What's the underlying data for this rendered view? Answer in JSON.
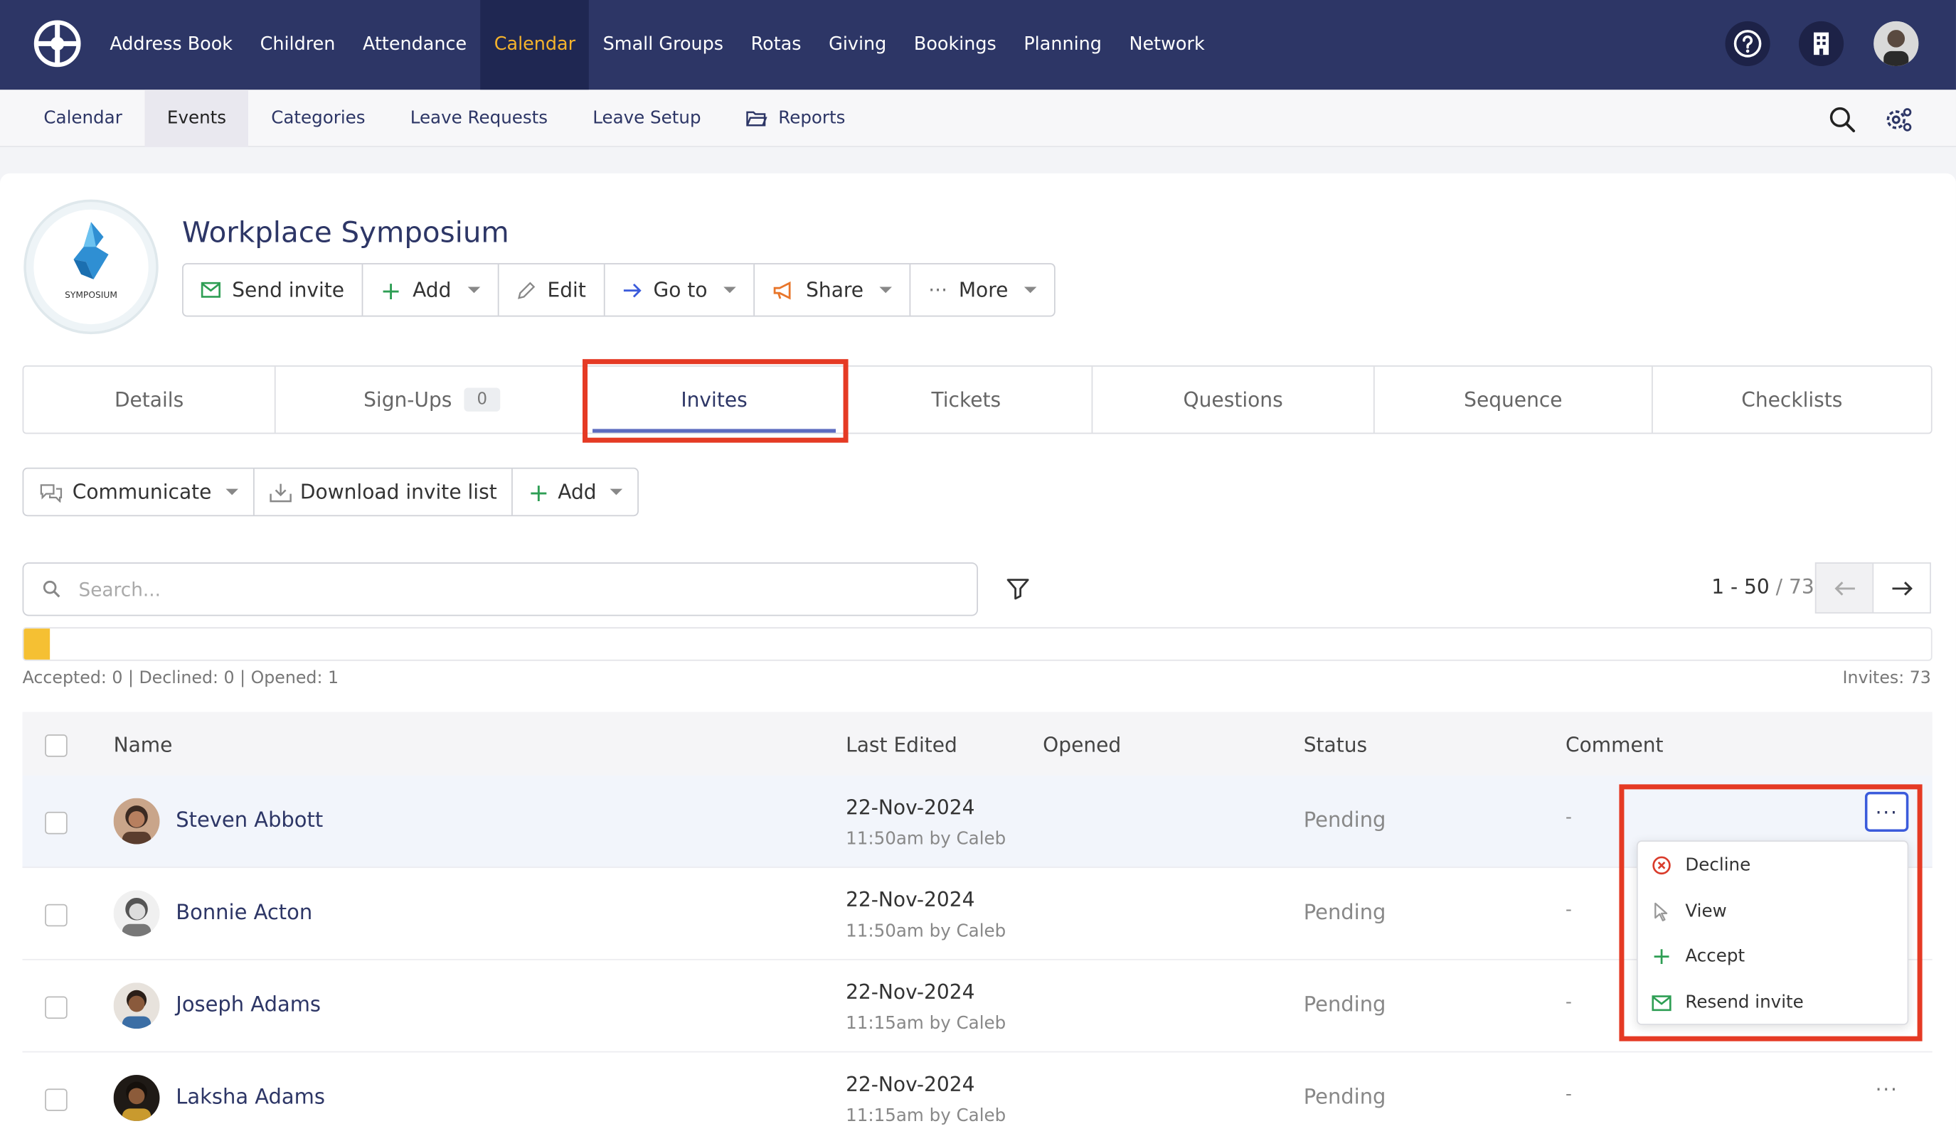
{
  "top_nav": {
    "items": [
      "Address Book",
      "Children",
      "Attendance",
      "Calendar",
      "Small Groups",
      "Rotas",
      "Giving",
      "Bookings",
      "Planning",
      "Network"
    ],
    "active": "Calendar",
    "icons": [
      "help-icon",
      "building-icon",
      "user-avatar"
    ]
  },
  "sub_nav": {
    "items": [
      "Calendar",
      "Events",
      "Categories",
      "Leave Requests",
      "Leave Setup",
      "Reports"
    ],
    "active": "Events",
    "icons": [
      "search-icon",
      "settings-icon"
    ]
  },
  "event": {
    "title": "Workplace Symposium",
    "logo_text": "SYMPOSIUM",
    "actions": {
      "send_invite": "Send invite",
      "add": "Add",
      "edit": "Edit",
      "go_to": "Go to",
      "share": "Share",
      "more": "More"
    }
  },
  "tabs": {
    "details": "Details",
    "signups": "Sign-Ups",
    "signups_count": "0",
    "invites": "Invites",
    "tickets": "Tickets",
    "questions": "Questions",
    "sequence": "Sequence",
    "checklists": "Checklists",
    "active": "Invites"
  },
  "toolbar": {
    "communicate": "Communicate",
    "download": "Download invite list",
    "add": "Add"
  },
  "search": {
    "placeholder": "Search..."
  },
  "pager": {
    "range": "1 - 50",
    "total": "/ 73"
  },
  "progress": {
    "opened_fraction": 0.0137
  },
  "stats": {
    "summary": "Accepted: 0 | Declined: 0 | Opened: 1",
    "invites": "Invites: 73"
  },
  "table": {
    "headers": {
      "name": "Name",
      "last_edited": "Last Edited",
      "opened": "Opened",
      "status": "Status",
      "comment": "Comment"
    },
    "rows": [
      {
        "name": "Steven Abbott",
        "date": "22-Nov-2024",
        "edited": "11:50am by Caleb",
        "status": "Pending",
        "comment": "-"
      },
      {
        "name": "Bonnie Acton",
        "date": "22-Nov-2024",
        "edited": "11:50am by Caleb",
        "status": "Pending",
        "comment": "-"
      },
      {
        "name": "Joseph Adams",
        "date": "22-Nov-2024",
        "edited": "11:15am by Caleb",
        "status": "Pending",
        "comment": "-"
      },
      {
        "name": "Laksha Adams",
        "date": "22-Nov-2024",
        "edited": "11:15am by Caleb",
        "status": "Pending",
        "comment": "-"
      }
    ]
  },
  "row_menu": {
    "dots": "···",
    "items": [
      "Decline",
      "View",
      "Accept",
      "Resend invite"
    ]
  },
  "colors": {
    "nav_bg": "#2d3666",
    "accent": "#f5b32c",
    "highlight": "#e53a24",
    "progress": "#f5c033"
  }
}
